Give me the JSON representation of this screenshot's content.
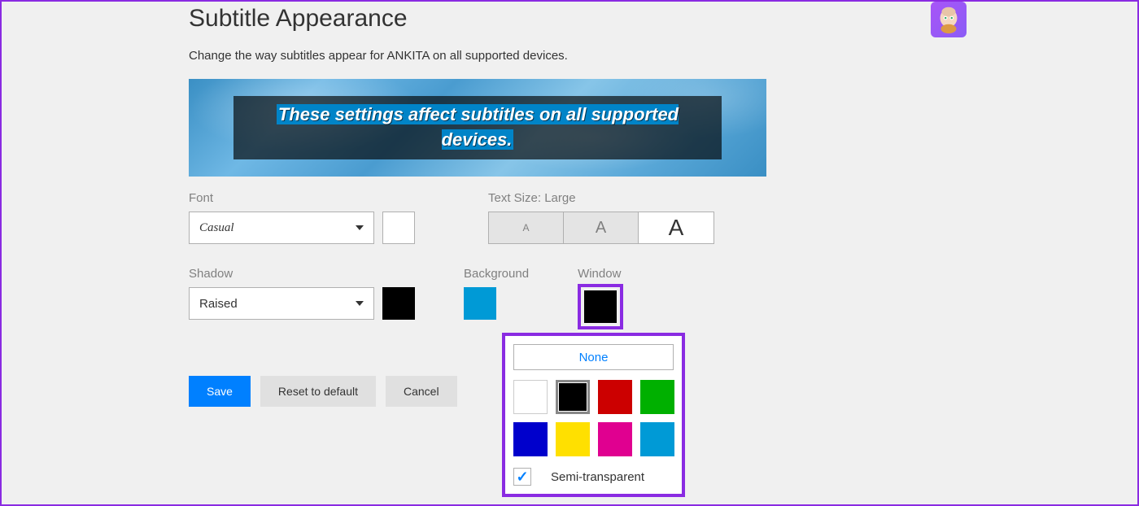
{
  "header": {
    "title": "Subtitle Appearance",
    "subtitle": "Change the way subtitles appear for ANKITA on all supported devices."
  },
  "preview": {
    "text": "These settings affect subtitles on all supported devices."
  },
  "font": {
    "label": "Font",
    "value": "Casual"
  },
  "textSize": {
    "label": "Text Size: Large",
    "glyph": "A"
  },
  "shadow": {
    "label": "Shadow",
    "value": "Raised",
    "color": "#000000"
  },
  "background": {
    "label": "Background",
    "color": "#009ad6"
  },
  "window": {
    "label": "Window",
    "color": "#000000"
  },
  "buttons": {
    "save": "Save",
    "reset": "Reset to default",
    "cancel": "Cancel"
  },
  "popup": {
    "none": "None",
    "semi": "Semi-transparent",
    "colors": [
      "#ffffff",
      "#000000",
      "#cc0000",
      "#00b000",
      "#0000cc",
      "#ffe000",
      "#e00090",
      "#009ad6"
    ]
  }
}
